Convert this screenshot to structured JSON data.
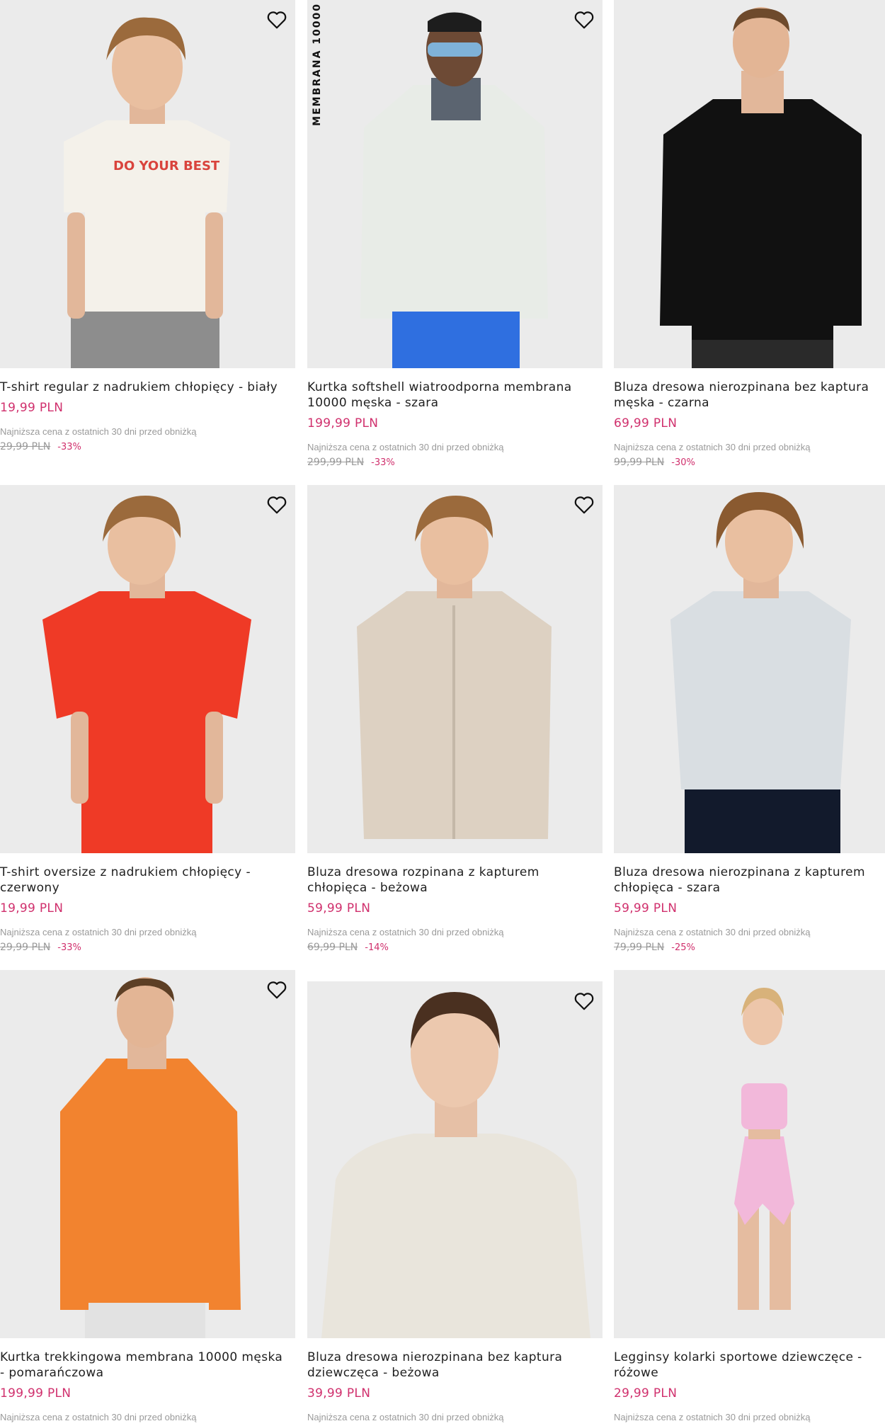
{
  "colors": {
    "price": "#d0306d",
    "muted": "#9a9a9a",
    "image_bg": "#ebebeb"
  },
  "wishlist_icon": "heart-icon",
  "products": [
    {
      "title": "T-shirt regular z nadrukiem chłopięcy - biały",
      "price": "19,99 PLN",
      "lowest_label": "Najniższa cena z ostatnich 30 dni przed obniżką",
      "old_price": "29,99 PLN",
      "discount": "-33%",
      "print_text": "DO YOUR BEST"
    },
    {
      "title": "Kurtka softshell wiatroodporna membrana 10000 męska - szara",
      "price": "199,99 PLN",
      "lowest_label": "Najniższa cena z ostatnich 30 dni przed obniżką",
      "old_price": "299,99 PLN",
      "discount": "-33%",
      "badge": "MEMBRANA 10000"
    },
    {
      "title": "Bluza dresowa nierozpinana bez kaptura męska - czarna",
      "price": "69,99 PLN",
      "lowest_label": "Najniższa cena z ostatnich 30 dni przed obniżką",
      "old_price": "99,99 PLN",
      "discount": "-30%"
    },
    {
      "title": "T-shirt oversize z nadrukiem chłopięcy - czerwony",
      "price": "19,99 PLN",
      "lowest_label": "Najniższa cena z ostatnich 30 dni przed obniżką",
      "old_price": "29,99 PLN",
      "discount": "-33%"
    },
    {
      "title": "Bluza dresowa rozpinana z kapturem chłopięca - beżowa",
      "price": "59,99 PLN",
      "lowest_label": "Najniższa cena z ostatnich 30 dni przed obniżką",
      "old_price": "69,99 PLN",
      "discount": "-14%"
    },
    {
      "title": "Bluza dresowa nierozpinana z kapturem chłopięca - szara",
      "price": "59,99 PLN",
      "lowest_label": "Najniższa cena z ostatnich 30 dni przed obniżką",
      "old_price": "79,99 PLN",
      "discount": "-25%"
    },
    {
      "title": "Kurtka trekkingowa membrana 10000 męska - pomarańczowa",
      "price": "199,99 PLN",
      "lowest_label": "Najniższa cena z ostatnich 30 dni przed obniżką"
    },
    {
      "title": "Bluza dresowa nierozpinana bez kaptura dziewczęca - beżowa",
      "price": "39,99 PLN",
      "lowest_label": "Najniższa cena z ostatnich 30 dni przed obniżką"
    },
    {
      "title": "Legginsy kolarki sportowe dziewczęce - różowe",
      "price": "29,99 PLN",
      "lowest_label": "Najniższa cena z ostatnich 30 dni przed obniżką"
    }
  ]
}
